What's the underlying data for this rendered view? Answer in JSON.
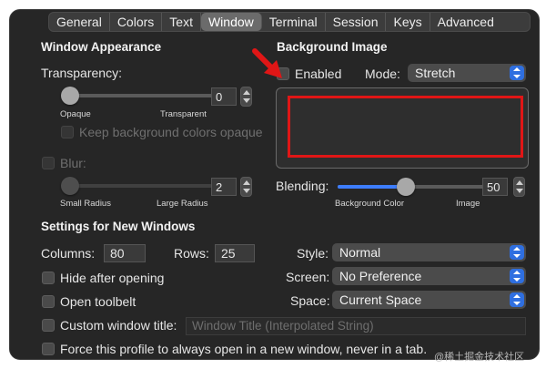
{
  "tabs": [
    "General",
    "Colors",
    "Text",
    "Window",
    "Terminal",
    "Session",
    "Keys",
    "Advanced"
  ],
  "active_tab": "Window",
  "window_appearance": {
    "title": "Window Appearance",
    "transparency_label": "Transparency:",
    "transparency_value": "0",
    "transparency_min_label": "Opaque",
    "transparency_max_label": "Transparent",
    "keep_bg_label": "Keep background colors opaque",
    "blur_label": "Blur:",
    "blur_value": "2",
    "blur_min_label": "Small Radius",
    "blur_max_label": "Large Radius"
  },
  "background_image": {
    "title": "Background Image",
    "enabled_label": "Enabled",
    "mode_label": "Mode:",
    "mode_value": "Stretch",
    "blending_label": "Blending:",
    "blending_value": "50",
    "blending_min_label": "Background Color",
    "blending_max_label": "Image"
  },
  "new_windows": {
    "title": "Settings for New Windows",
    "columns_label": "Columns:",
    "columns_value": "80",
    "rows_label": "Rows:",
    "rows_value": "25",
    "hide_after_opening": "Hide after opening",
    "open_toolbelt": "Open toolbelt",
    "custom_title_label": "Custom window title:",
    "custom_title_placeholder": "Window Title (Interpolated String)",
    "force_new_window": "Force this profile to always open in a new window, never in a tab.",
    "style_label": "Style:",
    "style_value": "Normal",
    "screen_label": "Screen:",
    "screen_value": "No Preference",
    "space_label": "Space:",
    "space_value": "Current Space"
  },
  "watermark": "@稀土掘金技术社区",
  "colors": {
    "accent": "#2f6fe0",
    "highlight": "#e01616"
  }
}
